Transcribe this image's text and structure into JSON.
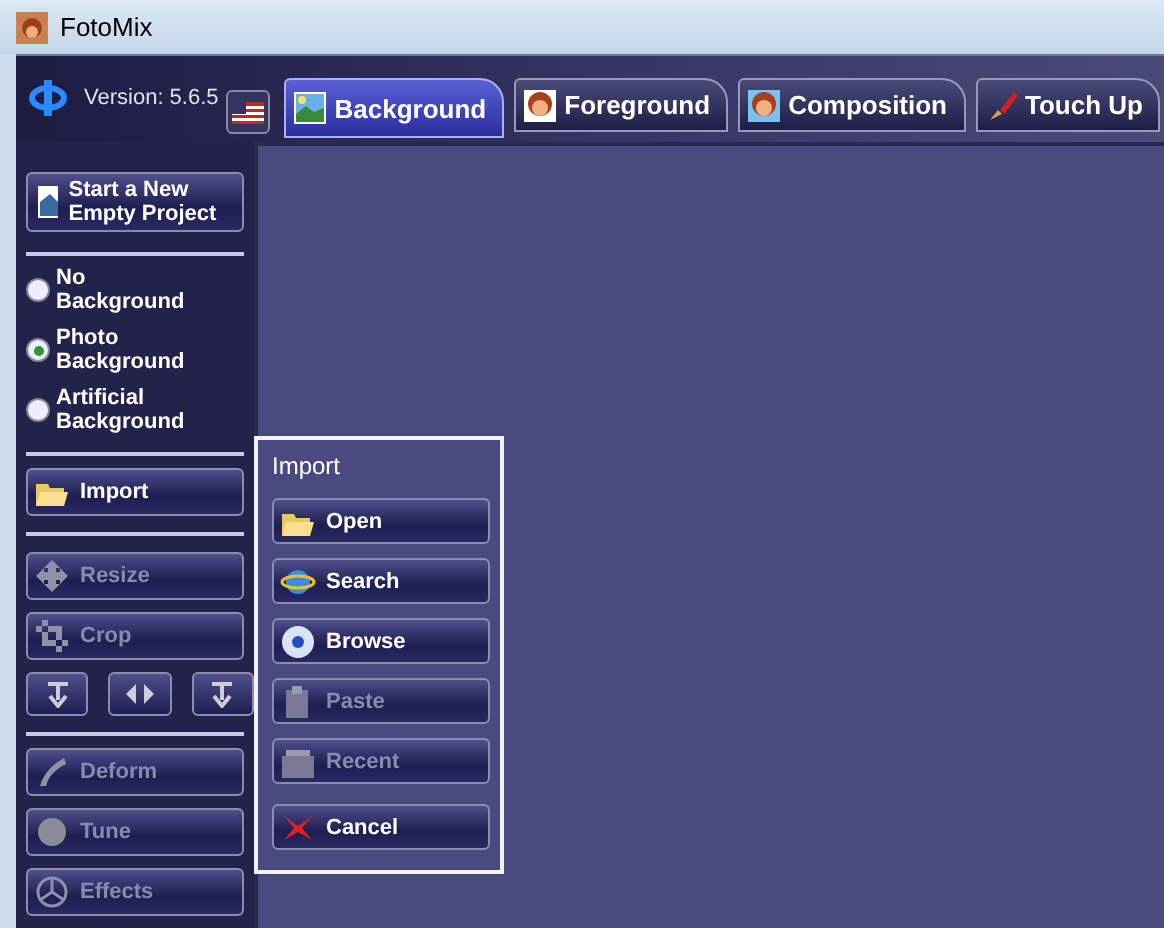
{
  "window": {
    "title": "FotoMix"
  },
  "header": {
    "version": "Version: 5.6.5"
  },
  "tabs": [
    {
      "label": "Background",
      "selected": true
    },
    {
      "label": "Foreground",
      "selected": false
    },
    {
      "label": "Composition",
      "selected": false
    },
    {
      "label": "Touch Up",
      "selected": false
    }
  ],
  "sidebar": {
    "new_project": "Start a New Empty Project",
    "background_options": [
      {
        "label": "No Background",
        "selected": false
      },
      {
        "label": "Photo Background",
        "selected": true
      },
      {
        "label": "Artificial Background",
        "selected": false
      }
    ],
    "import": {
      "label": "Import",
      "disabled": false
    },
    "tools": [
      {
        "label": "Resize",
        "disabled": true
      },
      {
        "label": "Crop",
        "disabled": true
      }
    ],
    "effects": [
      {
        "label": "Deform",
        "disabled": true
      },
      {
        "label": "Tune",
        "disabled": true
      },
      {
        "label": "Effects",
        "disabled": true
      }
    ]
  },
  "import_menu": {
    "title": "Import",
    "items": [
      {
        "label": "Open",
        "disabled": false
      },
      {
        "label": "Search",
        "disabled": false
      },
      {
        "label": "Browse",
        "disabled": false
      },
      {
        "label": "Paste",
        "disabled": true
      },
      {
        "label": "Recent",
        "disabled": true
      },
      {
        "label": "Cancel",
        "disabled": false
      }
    ]
  }
}
